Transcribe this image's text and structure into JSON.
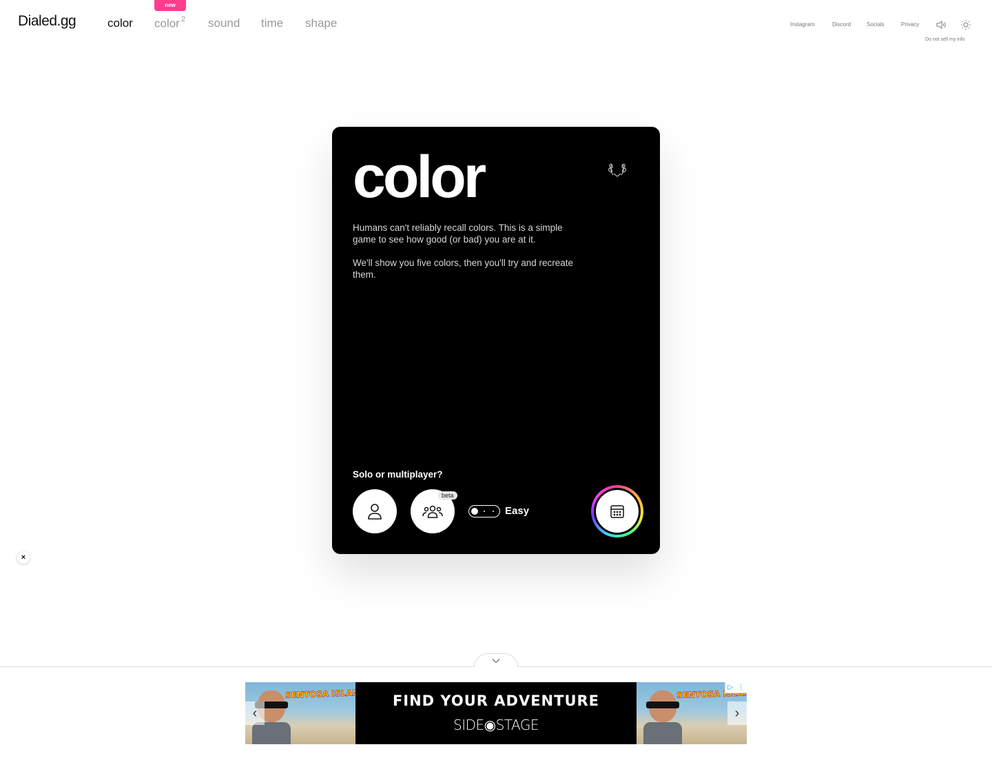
{
  "header": {
    "logo": "Dialed.gg",
    "nav": [
      {
        "label": "color",
        "active": true
      },
      {
        "label": "color",
        "sup": "2",
        "badge": "new"
      },
      {
        "label": "sound"
      },
      {
        "label": "time"
      },
      {
        "label": "shape"
      }
    ],
    "links": [
      "Instagram",
      "Discord",
      "Socials",
      "Privacy"
    ],
    "icons": [
      "speaker-icon",
      "sun-icon"
    ],
    "do_not_sell": "Do not sell my info",
    "accent": "#ff3d8b"
  },
  "card": {
    "title": "color",
    "description": [
      "Humans can't reliably recall colors. This is a simple game to see how good (or bad) you are at it.",
      "We'll show you five colors, then you'll try and recreate them."
    ],
    "mode_question": "Solo or multiplayer?",
    "multiplayer_badge": "beta",
    "difficulty": "Easy",
    "background": "#000000"
  },
  "close_button": "×",
  "ad": {
    "tag": "SENTOSA ISLAND",
    "headline": "FIND YOUR ADVENTURE",
    "brand": "SIDE◉STAGE"
  }
}
